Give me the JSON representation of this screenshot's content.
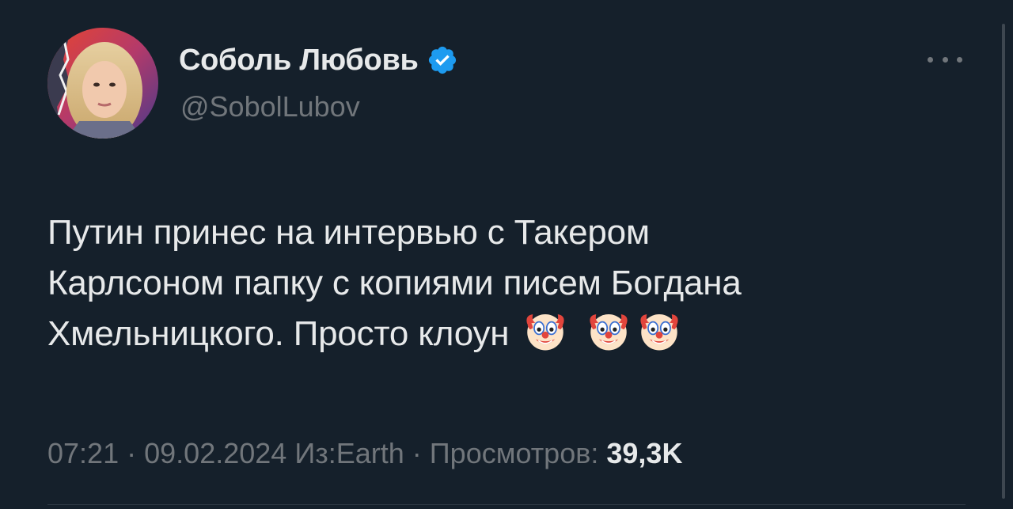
{
  "author": {
    "display_name": "Соболь Любовь",
    "handle": "@SobolLubov",
    "verified": true,
    "verified_color": "#1d9bf0"
  },
  "tweet": {
    "text_lines": [
      "Путин принес на интервью с Такером",
      "Карлсоном папку с копиями писем Богдана",
      "Хмельницкого. Просто клоун"
    ],
    "emojis": [
      "clown-face",
      "clown-face",
      "clown-face"
    ]
  },
  "meta": {
    "time": "07:21",
    "separator": "·",
    "date": "09.02.2024",
    "source": "Из:Earth",
    "views_label": "Просмотров:",
    "views_count": "39,3K"
  },
  "icons": {
    "more": "more-horizontal-icon",
    "verified": "verified-badge-icon"
  },
  "colors": {
    "background": "#15202b",
    "text_primary": "#e7e9ea",
    "text_secondary": "#71767b"
  }
}
